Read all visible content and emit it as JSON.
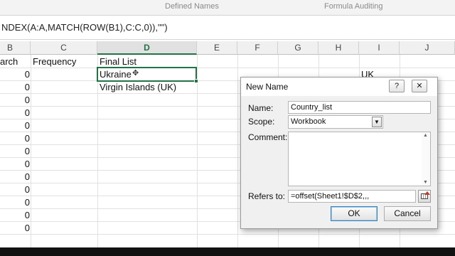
{
  "ribbon": {
    "groups": [
      "Defined Names",
      "Formula Auditing"
    ]
  },
  "formula_bar": {
    "text": "NDEX(A:A,MATCH(ROW(B1),C:C,0)),\"\")"
  },
  "sheet": {
    "columns": [
      "B",
      "C",
      "D",
      "E",
      "F",
      "G",
      "H",
      "I",
      "J"
    ],
    "active_column": "D",
    "headers": {
      "b": "arch",
      "c": "Frequency",
      "d": "Final List"
    },
    "column_b_values": [
      "0",
      "0",
      "0",
      "0",
      "0",
      "0",
      "0",
      "0",
      "0",
      "0",
      "0",
      "0",
      "0"
    ],
    "column_d_values": [
      "Ukraine",
      "Virgin Islands (UK)"
    ],
    "column_i_values": [
      "UK"
    ],
    "active_cell_value": "Ukraine"
  },
  "dialog": {
    "title": "New Name",
    "help_glyph": "?",
    "close_glyph": "✕",
    "name_label": "Name:",
    "name_value": "Country_list",
    "scope_label": "Scope:",
    "scope_value": "Workbook",
    "comment_label": "Comment:",
    "comment_value": "",
    "refers_to_label": "Refers to:",
    "refers_to_value": "=offset(Sheet1!$D$2,,,",
    "ok_label": "OK",
    "cancel_label": "Cancel"
  },
  "colors": {
    "excel_green": "#217346",
    "dialog_bg": "#f0f0f0",
    "gridline": "#e1e1e1"
  }
}
